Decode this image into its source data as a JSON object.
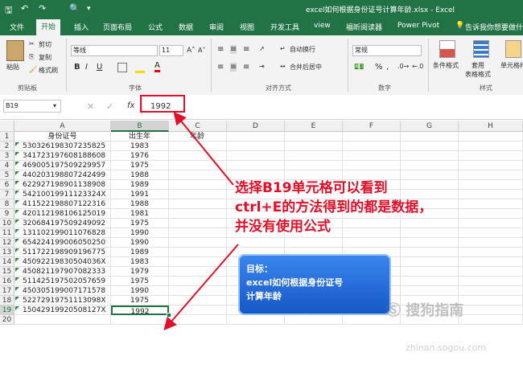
{
  "window": {
    "title": "excel如何根据身份证号计算年龄.xlsx  -  Excel"
  },
  "tabs": [
    "文件",
    "开始",
    "插入",
    "页面布局",
    "公式",
    "数据",
    "审阅",
    "视图",
    "开发工具",
    "view",
    "福昕阅读器",
    "Power Pivot"
  ],
  "tell_me": "告诉我你想要做什么",
  "ribbon": {
    "clipboard": {
      "paste": "粘贴",
      "cut": "剪切",
      "copy": "复制",
      "format_painter": "格式刷",
      "label": "剪贴板"
    },
    "font": {
      "name": "等线",
      "size": "11",
      "label": "字体",
      "bold": "B",
      "italic": "I",
      "underline": "U"
    },
    "alignment": {
      "wrap": "自动换行",
      "merge": "合并后居中",
      "label": "对齐方式"
    },
    "number": {
      "format": "常规",
      "percent": "%",
      "comma": ",",
      "label": "数字"
    },
    "styles": {
      "conditional": "条件格式",
      "table_line1": "套用",
      "table_line2": "表格格式",
      "cell_styles": "单元格样式",
      "label": "样式"
    }
  },
  "formula_bar": {
    "name_box": "B19",
    "fx": "fx",
    "value": "1992"
  },
  "grid": {
    "columns": [
      "A",
      "B",
      "C",
      "D",
      "E",
      "F",
      "G",
      "H"
    ],
    "header_row": {
      "a": "身份证号",
      "b": "出生年",
      "c": "年龄"
    },
    "rows": [
      {
        "n": "1"
      },
      {
        "n": "2",
        "a": "530326198307235825",
        "b": "1983"
      },
      {
        "n": "3",
        "a": "341723197608188608",
        "b": "1976"
      },
      {
        "n": "4",
        "a": "469005197509229957",
        "b": "1975"
      },
      {
        "n": "5",
        "a": "440203198807242499",
        "b": "1988"
      },
      {
        "n": "6",
        "a": "622927198901138908",
        "b": "1989"
      },
      {
        "n": "7",
        "a": "54210019911123324X",
        "b": "1991"
      },
      {
        "n": "8",
        "a": "411522198807122316",
        "b": "1988"
      },
      {
        "n": "9",
        "a": "420112198106125019",
        "b": "1981"
      },
      {
        "n": "10",
        "a": "320684197509249092",
        "b": "1975"
      },
      {
        "n": "11",
        "a": "131102199011076828",
        "b": "1990"
      },
      {
        "n": "12",
        "a": "654224199006050250",
        "b": "1990"
      },
      {
        "n": "13",
        "a": "511722198909196775",
        "b": "1989"
      },
      {
        "n": "14",
        "a": "45092219830504036X",
        "b": "1983"
      },
      {
        "n": "15",
        "a": "450821197907082333",
        "b": "1979"
      },
      {
        "n": "16",
        "a": "511425197502057659",
        "b": "1975"
      },
      {
        "n": "17",
        "a": "450305199007171578",
        "b": "1990"
      },
      {
        "n": "18",
        "a": "52272919751113098X",
        "b": "1975"
      },
      {
        "n": "19",
        "a": "15042919920508127X",
        "b": "1992"
      },
      {
        "n": "20"
      }
    ]
  },
  "annotation": {
    "line1": "选择B19单元格可以看到",
    "line2": "ctrl+E的方法得到的都是数据，",
    "line3": "并没有使用公式"
  },
  "goal_box": {
    "line1": "目标：",
    "line2": "excel如何根据身份证号",
    "line3": "计算年龄"
  },
  "watermark": {
    "cn": "搜狗指南",
    "url": "zhinan.sogou.com"
  },
  "colors": {
    "excel_green": "#217346",
    "annotation_red": "#e0102a",
    "goal_blue": "#1f6fe0"
  }
}
